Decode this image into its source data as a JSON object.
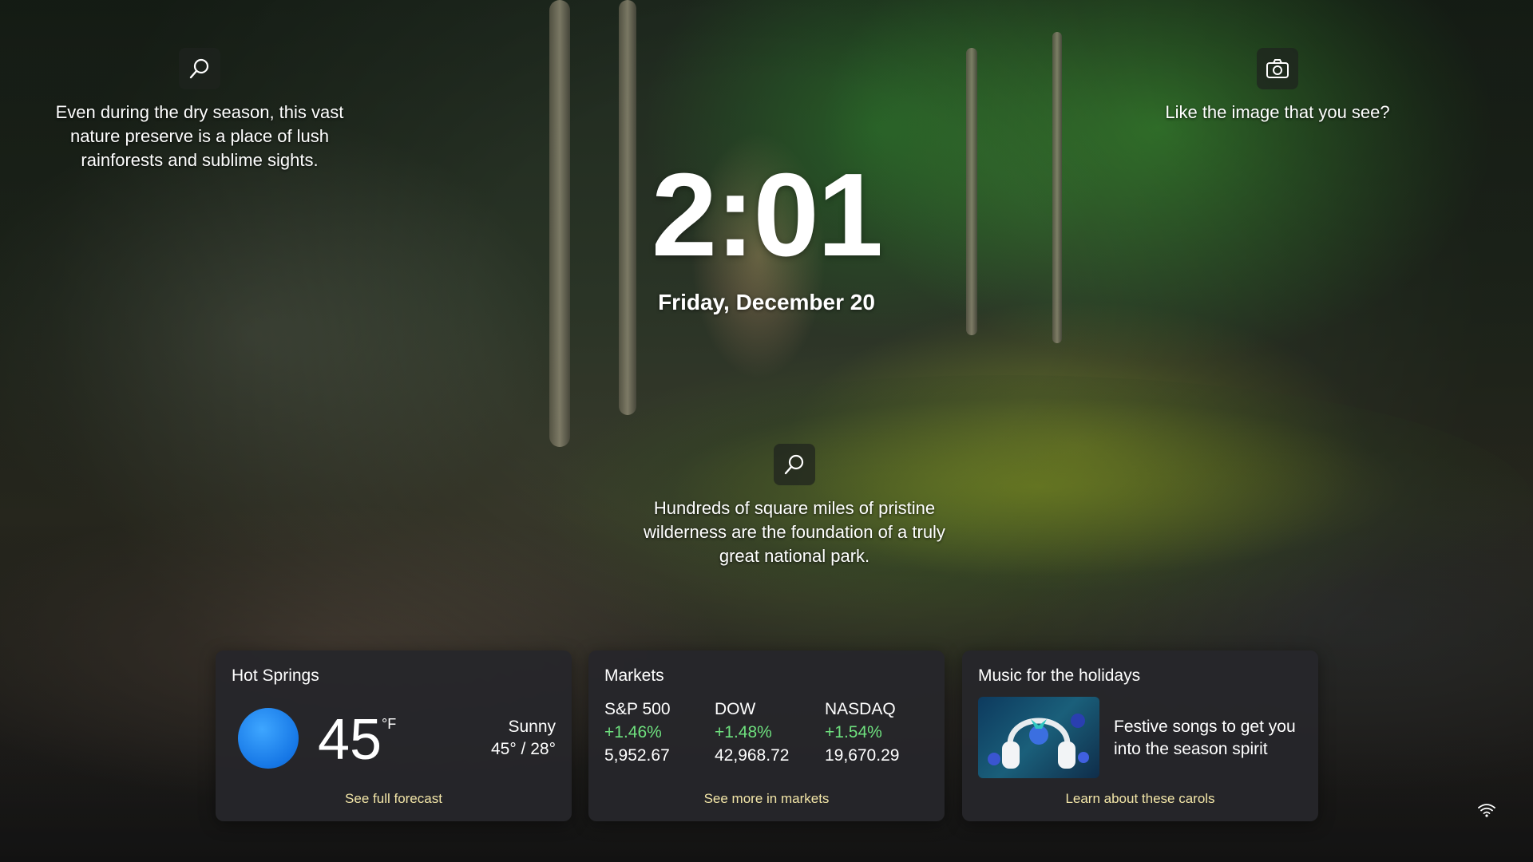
{
  "tips": [
    {
      "text": "Even during the dry season, this vast nature preserve is a place of lush rainforests and sublime sights.",
      "icon": "search-icon"
    },
    {
      "text": "Like the image that you see?",
      "icon": "camera-icon"
    },
    {
      "text": "Hundreds of square miles of pristine wilderness are the foundation of a truly great national park.",
      "icon": "search-icon"
    }
  ],
  "clock": {
    "time": "2:01",
    "date": "Friday, December 20"
  },
  "weather": {
    "title": "Hot Springs",
    "temp": "45",
    "unit": "°F",
    "condition": "Sunny",
    "range": "45° / 28°",
    "link": "See full forecast",
    "icon": "sun-icon"
  },
  "markets": {
    "title": "Markets",
    "items": [
      {
        "name": "S&P 500",
        "change": "+1.46%",
        "value": "5,952.67"
      },
      {
        "name": "DOW",
        "change": "+1.48%",
        "value": "42,968.72"
      },
      {
        "name": "NASDAQ",
        "change": "+1.54%",
        "value": "19,670.29"
      }
    ],
    "link": "See more in markets",
    "positive_color": "#6ee07e"
  },
  "music": {
    "title": "Music for the holidays",
    "text": "Festive songs to get you into the season spirit",
    "link": "Learn about these carols"
  },
  "status": {
    "icon": "wifi-icon"
  }
}
